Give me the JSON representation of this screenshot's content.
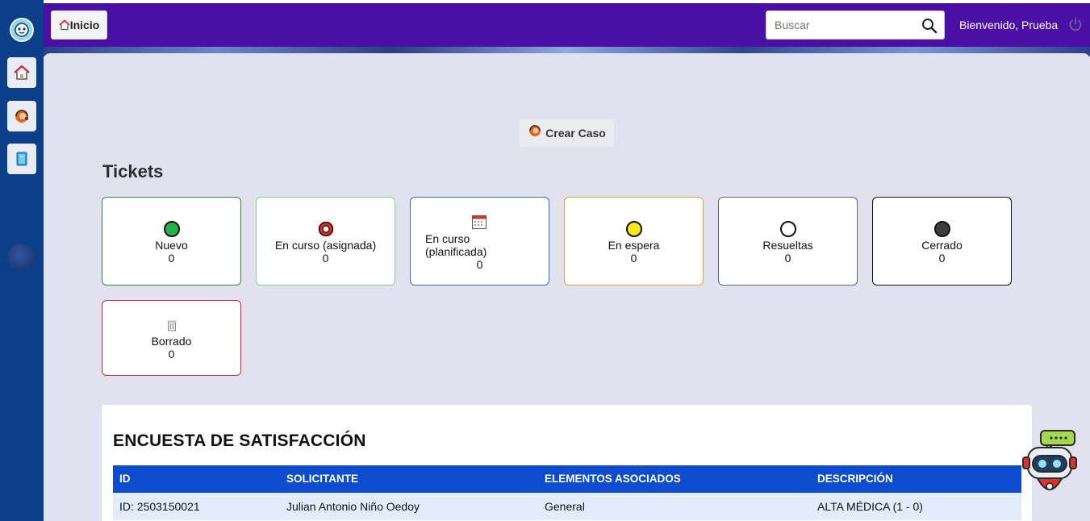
{
  "topbar": {
    "home_label": "Inicio",
    "search_placeholder": "Buscar",
    "welcome_text": "Bienvenido, Prueba"
  },
  "sidebar": {
    "items": [
      {
        "name": "home",
        "icon": "home-icon"
      },
      {
        "name": "create-case",
        "icon": "support-agent-icon"
      },
      {
        "name": "documents",
        "icon": "book-icon"
      }
    ]
  },
  "main": {
    "create_case_label": "Crear Caso",
    "tickets_title": "Tickets",
    "ticket_cards": [
      {
        "label": "Nuevo",
        "count": "0",
        "icon": "green-circle-icon",
        "border": "#2e8b3a"
      },
      {
        "label": "En curso (asignada)",
        "count": "0",
        "icon": "red-ring-icon",
        "border": "#7fd88f"
      },
      {
        "label_line1": "En curso",
        "label_line2": "(planificada)",
        "count": "0",
        "icon": "calendar-icon",
        "border": "#2f6fcf"
      },
      {
        "label": "En espera",
        "count": "0",
        "icon": "yellow-circle-icon",
        "border": "#e6a52a"
      },
      {
        "label": "Resueltas",
        "count": "0",
        "icon": "white-circle-icon",
        "border": "#666666"
      },
      {
        "label": "Cerrado",
        "count": "0",
        "icon": "dark-circle-icon",
        "border": "#111111"
      },
      {
        "label": "Borrado",
        "count": "0",
        "icon": "trash-icon",
        "border": "#d0282e"
      }
    ]
  },
  "survey": {
    "title": "ENCUESTA DE SATISFACCIÓN",
    "columns": [
      "ID",
      "SOLICITANTE",
      "ELEMENTOS ASOCIADOS",
      "DESCRIPCIÓN"
    ],
    "rows": [
      [
        "ID: 2503150021",
        "Julian Antonio Niño Oedoy",
        "General",
        "ALTA MÉDICA (1 - 0)"
      ]
    ]
  },
  "colors": {
    "topbar": "#4a10a6",
    "sidebar": "#0b3f8a",
    "content_bg": "#e2e1f0",
    "table_header": "#0d4ccf"
  }
}
